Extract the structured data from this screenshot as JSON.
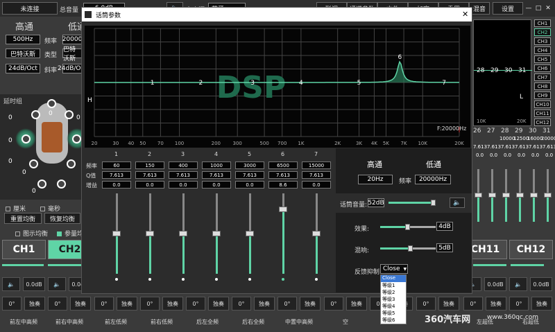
{
  "topbar": {
    "connect": "未连接",
    "master_label": "总音量",
    "master_value": "6.0dB",
    "source_label": "主音源",
    "source_value": "蓝牙",
    "buttons": [
      "联调",
      "通道参数",
      "文件",
      "加密",
      "重置",
      "混音",
      "设置"
    ]
  },
  "window_controls": {
    "min": "—",
    "max": "□",
    "close": "✕"
  },
  "left_panel": {
    "hp": "高通",
    "lp": "低通",
    "freq_value": "500Hz",
    "freq_label": "频率",
    "lp_freq": "20000",
    "type_value": "巴特沃斯",
    "type_label": "类型",
    "lp_type": "巴特沃斯",
    "slope_value": "24dB/Oct",
    "slope_label": "斜率",
    "lp_slope": "24dB/Oct",
    "delay_group": "延时组",
    "delay_values": [
      "0",
      "0",
      "0",
      "0",
      "0",
      "0",
      "0",
      "0",
      "0",
      "0",
      "0",
      "0"
    ],
    "unit_cm": "厘米",
    "unit_ms": "毫秒",
    "reset_eq": "重置均衡",
    "restore_eq": "恢复均衡",
    "graphic_eq": "图示均衡",
    "param_eq": "参量均"
  },
  "channel_tabs": [
    "CH1",
    "CH2",
    "CH11",
    "CH12"
  ],
  "right_channels": [
    "CH1",
    "CH2",
    "CH3",
    "CH4",
    "CH5",
    "CH6",
    "CH7",
    "CH8",
    "CH9",
    "CH10",
    "CH11",
    "CH12"
  ],
  "right_graph": {
    "labels": [
      "28",
      "29",
      "30",
      "31"
    ],
    "freq_left": "10K",
    "freq_right": "20K",
    "corner": "L"
  },
  "right_bands": {
    "numbers": [
      "26",
      "27",
      "28",
      "29",
      "30",
      "31"
    ],
    "freqs": [
      "10000",
      "12500",
      "16000",
      "20000"
    ],
    "q": [
      "7.613",
      "7.613",
      "7.613",
      "7.613",
      "7.613",
      "7.613"
    ],
    "gain": [
      "0.0",
      "0.0",
      "0.0",
      "0.0",
      "0.0",
      "0.0"
    ]
  },
  "bottom": {
    "mute_db": "0.0dB",
    "phase": "0°",
    "solo": "独奏",
    "names": [
      "前左中高频",
      "前右中高频",
      "前左低频",
      "前右低频",
      "后左全频",
      "后右全频",
      "中置中高频",
      "空",
      "",
      "",
      "左超低",
      "右超低"
    ]
  },
  "modal": {
    "title": "话筒参数",
    "close": "✕",
    "graph": {
      "watermark": "DSP",
      "x_ticks": [
        "20",
        "30",
        "40",
        "50",
        "70",
        "100",
        "200",
        "300",
        "500",
        "700",
        "1K",
        "2K",
        "3K",
        "4K",
        "5K",
        "7K",
        "10K",
        "20K"
      ],
      "band_labels": [
        "1",
        "2",
        "3",
        "4",
        "5",
        "6",
        "7"
      ],
      "h_label": "H",
      "freq_readout": "F:20000Hz"
    },
    "bands": {
      "numbers": [
        "1",
        "2",
        "3",
        "4",
        "5",
        "6",
        "7"
      ],
      "freq_label": "频率",
      "q_label": "Q值",
      "gain_label": "增益",
      "freqs": [
        "60",
        "150",
        "400",
        "1000",
        "3000",
        "6500",
        "15000"
      ],
      "q": [
        "7.613",
        "7.613",
        "7.613",
        "7.613",
        "7.613",
        "7.613",
        "7.613"
      ],
      "gains": [
        "0.0",
        "0.0",
        "0.0",
        "0.0",
        "0.0",
        "8.6",
        "0.0"
      ],
      "slider_levels": [
        0.5,
        0.5,
        0.5,
        0.5,
        0.5,
        0.8,
        0.5
      ]
    },
    "filters": {
      "hp": "高通",
      "lp": "低通",
      "hp_value": "20Hz",
      "freq_label": "频率",
      "lp_value": "20000Hz"
    },
    "mic_volume_label": "话筒音量:",
    "mic_volume_value": "52dB",
    "mic_volume_level": 0.95,
    "effect_label": "效果:",
    "effect_value": "4dB",
    "effect_level": 0.5,
    "reverb_label": "混响:",
    "reverb_value": "5dB",
    "reverb_level": 0.55,
    "feedback_label": "反馈抑制:",
    "feedback_value": "Close",
    "feedback_options": [
      "Close",
      "等级1",
      "等级2",
      "等级3",
      "等级4",
      "等级5",
      "等级6"
    ]
  },
  "watermark": {
    "brand": "360汽车网",
    "site": "www.360qc.com"
  },
  "colors": {
    "accent": "#5fd4a6",
    "bg": "#3a3a3a"
  }
}
